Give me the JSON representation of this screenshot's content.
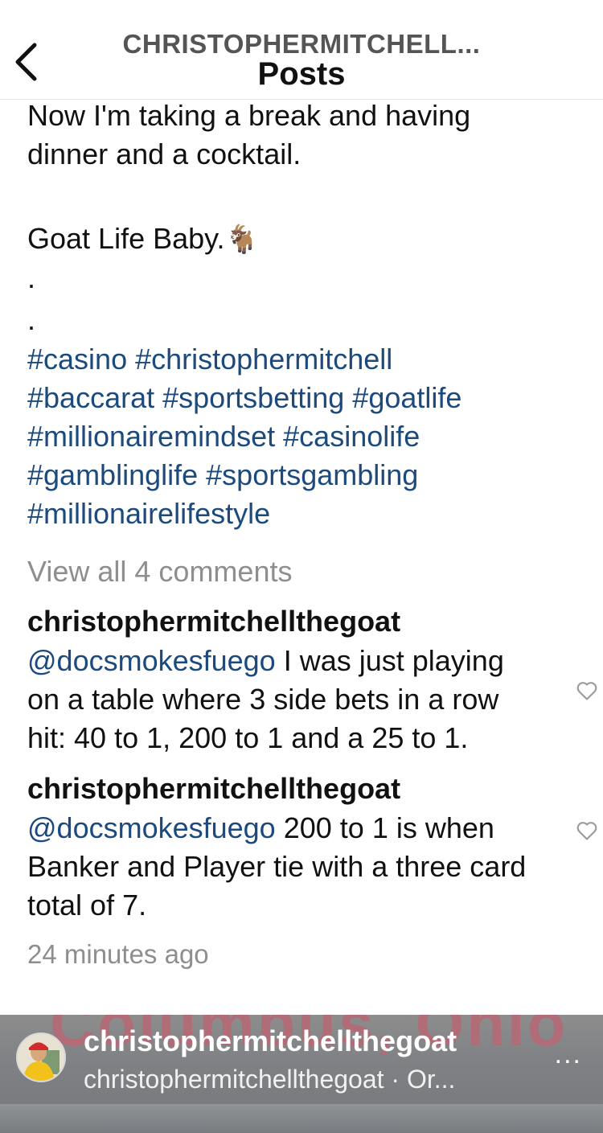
{
  "header": {
    "username": "CHRISTOPHERMITCHELL...",
    "title": "Posts"
  },
  "caption": {
    "line1": "Now I'm taking a break and having",
    "line2": "dinner and a cocktail.",
    "line3": "Goat Life Baby.",
    "emoji": "🐐",
    "dot1": ".",
    "dot2": "."
  },
  "hashtags": [
    "#casino",
    "#christophermitchell",
    "#baccarat",
    "#sportsbetting",
    "#goatlife",
    "#millionairemindset",
    "#casinolife",
    "#gamblinglife",
    "#sportsgambling",
    "#millionairelifestyle"
  ],
  "view_all_comments": "View all 4 comments",
  "comments": [
    {
      "user": "christophermitchellthegoat",
      "mention": "@docsmokesfuego",
      "text": " I was just playing on a table where 3 side bets in a row hit:  40 to 1, 200 to 1 and a 25 to 1."
    },
    {
      "user": "christophermitchellthegoat",
      "mention": "@docsmokesfuego",
      "text": " 200 to 1 is when Banker and Player tie with a three card total of 7."
    }
  ],
  "timestamp": "24 minutes ago",
  "footer": {
    "background_sign_text": "Columbus, Ohio",
    "username": "christophermitchellthegoat",
    "subtitle": "christophermitchellthegoat · Or...",
    "more": "..."
  },
  "colors": {
    "link": "#1c4a7d",
    "muted": "#8e8e8e"
  },
  "icons": {
    "back": "chevron-left-icon",
    "like": "heart-icon",
    "more": "more-options-icon"
  }
}
